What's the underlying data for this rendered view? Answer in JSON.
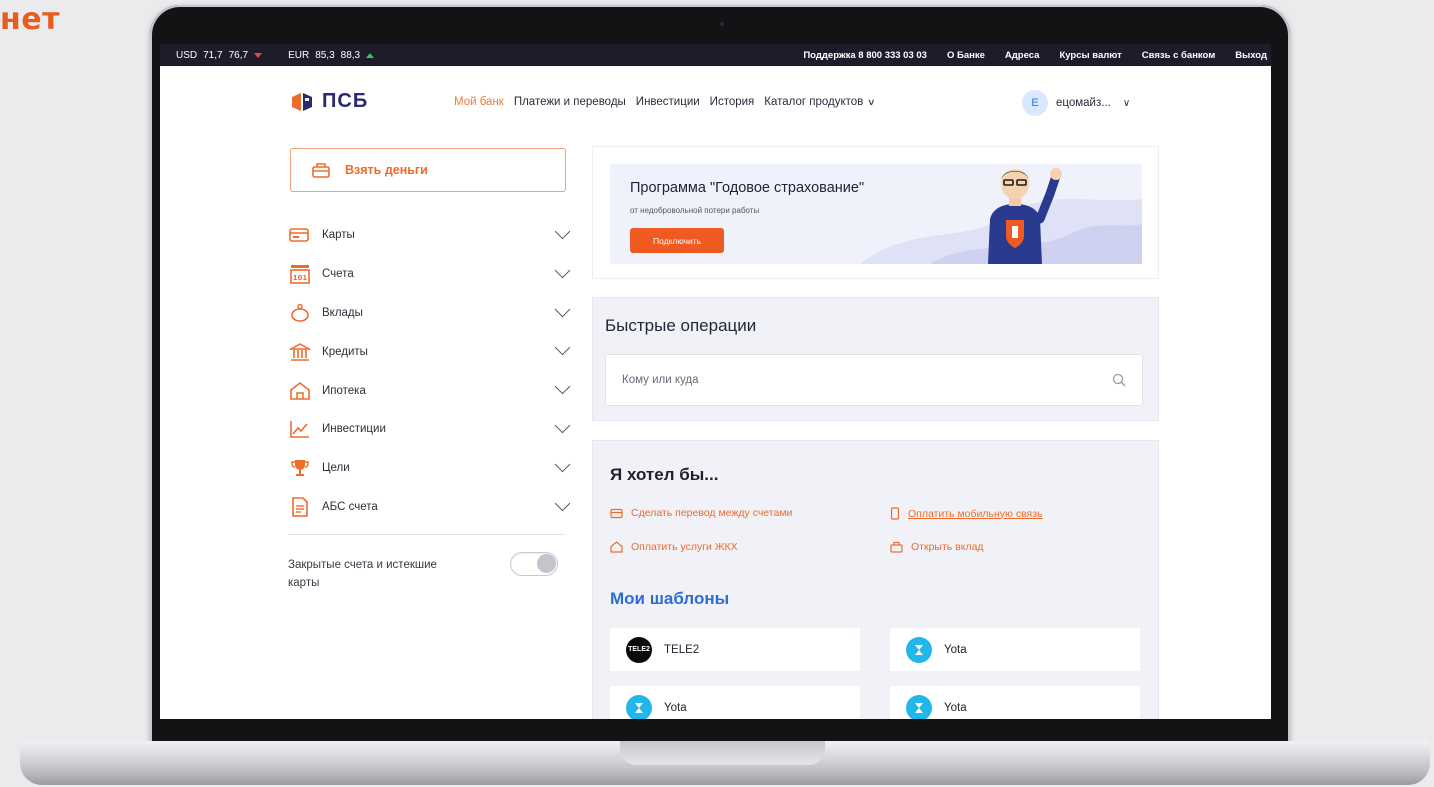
{
  "corner_text": "нет",
  "topbar": {
    "usd_label": "USD",
    "usd_buy": "71,7",
    "usd_sell": "76,7",
    "eur_label": "EUR",
    "eur_buy": "85,3",
    "eur_sell": "88,3",
    "links": [
      "Поддержка 8 800 333 03 03",
      "О Банке",
      "Адреса",
      "Курсы валют",
      "Связь с банком",
      "Выход"
    ]
  },
  "header": {
    "logo_text": "ПСБ",
    "nav": [
      {
        "label": "Мой банк",
        "active": true
      },
      {
        "label": "Платежи и переводы"
      },
      {
        "label": "Инвестиции"
      },
      {
        "label": "История"
      },
      {
        "label": "Каталог продуктов"
      }
    ],
    "avatar_letter": "Е",
    "user_name": "ецомайз..."
  },
  "sidebar": {
    "take_money": "Взять деньги",
    "items": [
      {
        "label": "Карты",
        "icon": "card-icon"
      },
      {
        "label": "Счета",
        "icon": "account-icon"
      },
      {
        "label": "Вклады",
        "icon": "piggy-bank-icon"
      },
      {
        "label": "Кредиты",
        "icon": "bank-icon"
      },
      {
        "label": "Ипотека",
        "icon": "house-icon"
      },
      {
        "label": "Инвестиции",
        "icon": "chart-icon"
      },
      {
        "label": "Цели",
        "icon": "trophy-icon"
      },
      {
        "label": "АБС счета",
        "icon": "document-icon"
      }
    ],
    "closed_label": "Закрытые счета и истекшие карты"
  },
  "promo": {
    "title": "Программа \"Годовое страхование\"",
    "subtitle": "от недобровольной потери работы",
    "button": "Подключить"
  },
  "quick": {
    "title": "Быстрые операции",
    "search_placeholder": "Кому или куда"
  },
  "wish": {
    "title": "Я хотел бы...",
    "links": [
      "Сделать перевод между счетами",
      "Оплатить мобильную связь",
      "Оплатить услуги ЖКХ",
      "Открыть вклад"
    ]
  },
  "templates": {
    "title": "Мои шаблоны",
    "items": [
      "TELE2",
      "Yota",
      "Yota",
      "Yota"
    ],
    "tele2_logo_text": "TELE2"
  },
  "colors": {
    "accent_orange": "#ee6b2c",
    "topbar_bg": "#1d1c2b",
    "link_blue": "#2e6cd6"
  }
}
